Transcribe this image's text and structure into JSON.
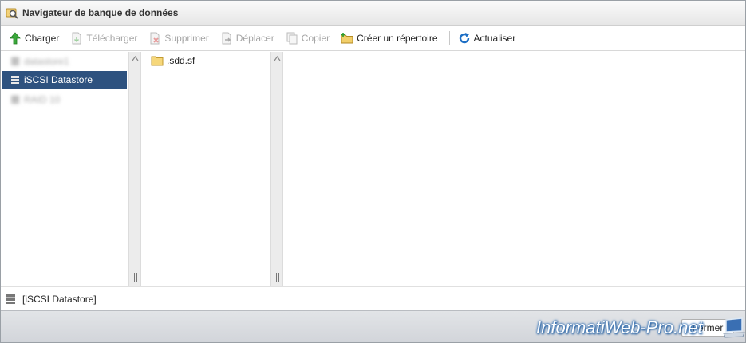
{
  "window": {
    "title": "Navigateur de banque de données"
  },
  "toolbar": {
    "upload": "Charger",
    "download": "Télécharger",
    "delete": "Supprimer",
    "move": "Déplacer",
    "copy": "Copier",
    "create_dir": "Créer un répertoire",
    "refresh": "Actualiser"
  },
  "datastores": [
    {
      "label": "datastore1"
    },
    {
      "label": "iSCSI Datastore"
    },
    {
      "label": "RAID 10"
    }
  ],
  "files": [
    {
      "name": ".sdd.sf"
    }
  ],
  "path": {
    "current": "[iSCSI Datastore]"
  },
  "footer": {
    "close": "Fermer"
  },
  "watermark": {
    "text": "InformatiWeb-Pro.net"
  },
  "colors": {
    "selection": "#2e527f",
    "toolbar_disabled": "#a6a6a6",
    "footer": "#d6d9dd"
  }
}
